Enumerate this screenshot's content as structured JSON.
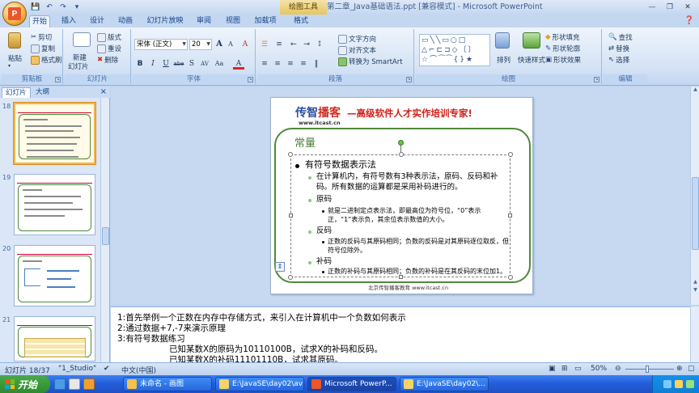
{
  "window": {
    "title": "第二章_Java基础语法.ppt [兼容模式] - Microsoft PowerPoint",
    "contextual_tab_group": "绘图工具"
  },
  "qat": {
    "save_icon": "save-icon",
    "undo_icon": "undo-icon",
    "redo_icon": "redo-icon"
  },
  "tabs": [
    "开始",
    "插入",
    "设计",
    "动画",
    "幻灯片放映",
    "审阅",
    "视图",
    "加载项",
    "格式"
  ],
  "ribbon": {
    "clipboard": {
      "label": "剪贴板",
      "paste": "粘贴",
      "cut": "剪切",
      "copy": "复制",
      "format_painter": "格式刷"
    },
    "slides": {
      "label": "幻灯片",
      "new_slide": "新建\n幻灯片",
      "new_slide_line1": "新建",
      "new_slide_line2": "幻灯片",
      "layout": "版式",
      "reset": "重设",
      "delete": "删除"
    },
    "font": {
      "label": "字体",
      "font_name": "宋体 (正文)",
      "font_size": "20",
      "bold": "B",
      "italic": "I",
      "underline": "U",
      "strike": "abe",
      "shadow": "S",
      "spacing": "AV",
      "case": "Aa",
      "grow": "A",
      "shrink": "A",
      "clear": "A"
    },
    "paragraph": {
      "label": "段落",
      "text_direction": "文字方向",
      "align_text": "对齐文本",
      "smartart": "转换为 SmartArt"
    },
    "drawing": {
      "label": "绘图",
      "arrange": "排列",
      "quick_styles": "快速样式",
      "shape_fill": "形状填充",
      "shape_outline": "形状轮廓",
      "shape_effects": "形状效果"
    },
    "editing": {
      "label": "编辑",
      "find": "查找",
      "replace": "替换",
      "select": "选择"
    }
  },
  "left_pane": {
    "tab_slides": "幻灯片",
    "tab_outline": "大纲",
    "close": "×",
    "thumbnails": [
      {
        "num": "18",
        "selected": true
      },
      {
        "num": "19",
        "selected": false
      },
      {
        "num": "20",
        "selected": false
      },
      {
        "num": "21",
        "selected": false
      }
    ]
  },
  "slide": {
    "brand_a": "传智",
    "brand_b": "播客",
    "slogan": "—高级软件人才实作培训专家!",
    "url": "www.itcast.cn",
    "title": "常量",
    "bullets": [
      {
        "level": 1,
        "text": "有符号数据表示法"
      },
      {
        "level": 2,
        "text": "在计算机内，有符号数有3种表示法，原码、反码和补码。所有数据的运算都是采用补码进行的。"
      },
      {
        "level": 2,
        "text": "原码"
      },
      {
        "level": 3,
        "text": "就是二进制定点表示法，即最高位为符号位，“0”表示正，“1”表示负，其余位表示数值的大小。"
      },
      {
        "level": 2,
        "text": "反码"
      },
      {
        "level": 3,
        "text": "正数的反码与其原码相同；负数的反码是对其原码逐位取反，但符号位除外。"
      },
      {
        "level": 2,
        "text": "补码"
      },
      {
        "level": 3,
        "text": "正数的补码与其原码相同；负数的补码是在其反码的末位加1。"
      }
    ],
    "footer": "北京传智播客教育 www.itcast.cn"
  },
  "notes": [
    "1:首先举例一个正数在内存中存储方式，来引入在计算机中一个负数如何表示",
    "2:通过数据+7,-7来演示原理",
    "3:有符号数据练习",
    "已知某数X的原码为10110100B，试求X的补码和反码。",
    "已知某数X的补码11101110B，试求其原码。"
  ],
  "status": {
    "slide_pos": "幻灯片 18/37",
    "theme": "\"1_Studio\"",
    "language": "中文(中国)",
    "zoom": "50%"
  },
  "taskbar": {
    "start": "开始",
    "items": [
      {
        "label": "未命名 - 画图",
        "active": false
      },
      {
        "label": "E:\\JavaSE\\day02\\avi",
        "active": false
      },
      {
        "label": "Microsoft PowerP...",
        "active": true
      },
      {
        "label": "E:\\JavaSE\\day02\\...",
        "active": false
      }
    ]
  },
  "colors": {
    "ribbon_blue": "#c4d7f0",
    "brand_blue": "#2b4f9e",
    "brand_red": "#d02a20",
    "frame_green": "#4e8a3a",
    "taskbar_blue": "#245edb",
    "start_green": "#3a9b3a"
  }
}
